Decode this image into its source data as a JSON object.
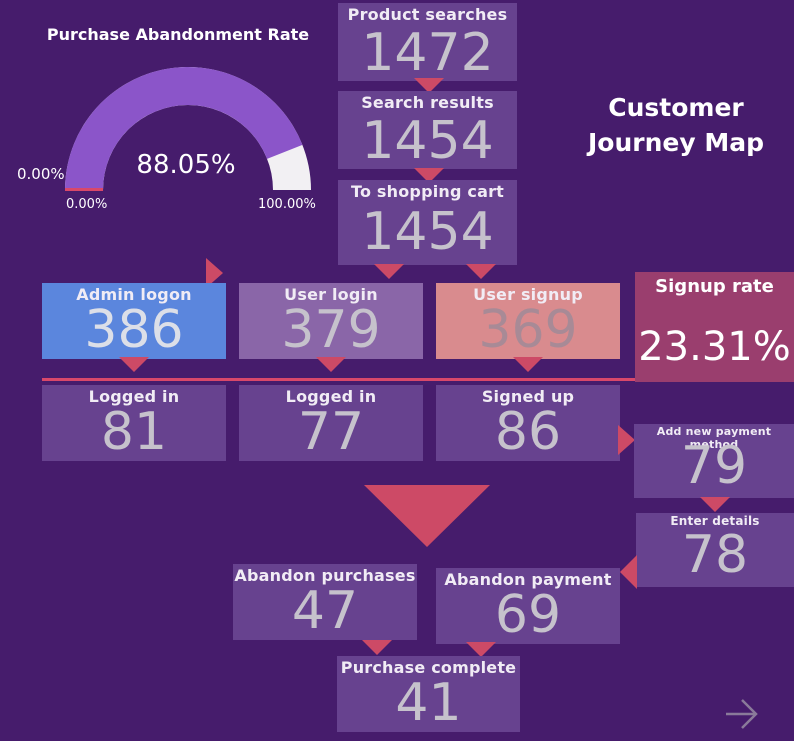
{
  "title": "Customer Journey Map",
  "gauge": {
    "title": "Purchase Abandonment Rate",
    "value_label": "88.05%",
    "value_fraction": 0.8805,
    "min_label": "0.00%",
    "max_label": "100.00%",
    "target_label": "0.00%",
    "fill_color": "#8b55c9",
    "rest_color": "#f2f0f3"
  },
  "funnel": {
    "product_searches": {
      "label": "Product searches",
      "value": "1472"
    },
    "search_results": {
      "label": "Search results",
      "value": "1454"
    },
    "to_shopping_cart": {
      "label": "To shopping cart",
      "value": "1454"
    },
    "admin_logon": {
      "label": "Admin logon",
      "value": "386"
    },
    "user_login": {
      "label": "User login",
      "value": "379"
    },
    "user_signup": {
      "label": "User signup",
      "value": "369"
    },
    "admin_logged_in": {
      "label": "Logged in",
      "value": "81"
    },
    "user_logged_in": {
      "label": "Logged in",
      "value": "77"
    },
    "signed_up": {
      "label": "Signed up",
      "value": "86"
    },
    "add_payment": {
      "label": "Add new payment method",
      "value": "79"
    },
    "enter_details": {
      "label": "Enter details",
      "value": "78"
    },
    "abandon_purchases": {
      "label": "Abandon purchases",
      "value": "47"
    },
    "abandon_payment": {
      "label": "Abandon payment",
      "value": "69"
    },
    "purchase_complete": {
      "label": "Purchase complete",
      "value": "41"
    }
  },
  "signup_rate": {
    "label": "Signup rate",
    "value": "23.31%"
  },
  "colors": {
    "background": "#461c6c",
    "card": "#67428f",
    "admin_card": "#5b86dd",
    "user_login_card": "#8a66a8",
    "user_signup_card": "#d98b8e",
    "signup_rate_card": "#9a3e6e",
    "arrow": "#cd4a66"
  },
  "nav": {
    "next_icon": "arrow-right-icon"
  }
}
